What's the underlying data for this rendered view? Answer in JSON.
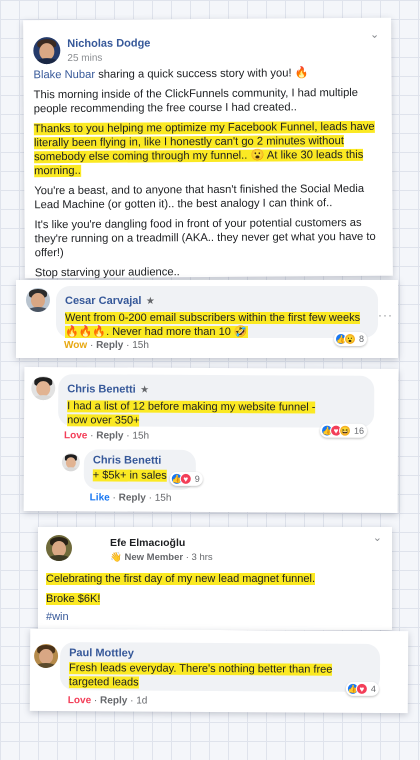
{
  "post": {
    "author": "Nicholas Dodge",
    "time": "25 mins",
    "intro_name": "Blake Nubar",
    "intro_text": "sharing a quick success story with you! 🔥",
    "p1": "This morning inside of the ClickFunnels community, I had multiple people recommending the free course I had created..",
    "p2": "Thanks to you helping me optimize my Facebook Funnel, leads have literally been flying in, like I honestly can't go 2 minutes without somebody else coming through my funnel.. 😮 At like 30 leads this morning..",
    "p3": "You're a beast, and to anyone that hasn't finished the Social Media Lead Machine (or gotten it).. the best analogy I can think of..",
    "p4": "It's like you're dangling food in front of your potential customers as they're running on a treadmill (AKA.. they never get what you have to offer!)",
    "p5": "Stop starving your audience.."
  },
  "comments": [
    {
      "name": "Cesar Carvajal",
      "text": "Went from 0-200 email subscribers within the first few weeks🔥🔥🔥. Never had more than 10 🤣",
      "reaction_label": "Wow",
      "reply": "Reply",
      "time": "15h",
      "count": "8"
    },
    {
      "name": "Chris Benetti",
      "text": "I had a list of 12 before making my website funnel - now over 350+",
      "reaction_label": "Love",
      "reply": "Reply",
      "time": "15h",
      "count": "16"
    },
    {
      "name": "Chris Benetti",
      "text": "+ $5k+ in sales",
      "reaction_label": "Like",
      "reply": "Reply",
      "time": "15h",
      "count": "9"
    }
  ],
  "efe": {
    "name": "Efe Elmacıoğlu",
    "badge": "New Member",
    "time": "3 hrs",
    "line1": "Celebrating the first day of my new lead magnet funnel.",
    "line2": "Broke $6K!",
    "tag": "#win"
  },
  "paul": {
    "name": "Paul Mottley",
    "text": "Fresh leads everyday. There's nothing better than free targeted leads",
    "reaction_label": "Love",
    "reply": "Reply",
    "time": "1d",
    "count": "4"
  },
  "separators": {
    "dot": "·",
    "more": "···"
  },
  "colors": {
    "highlight": "#fbe923",
    "link": "#365899",
    "like": "#1877f2",
    "love": "#f33e58",
    "wow": "#f7b125"
  }
}
